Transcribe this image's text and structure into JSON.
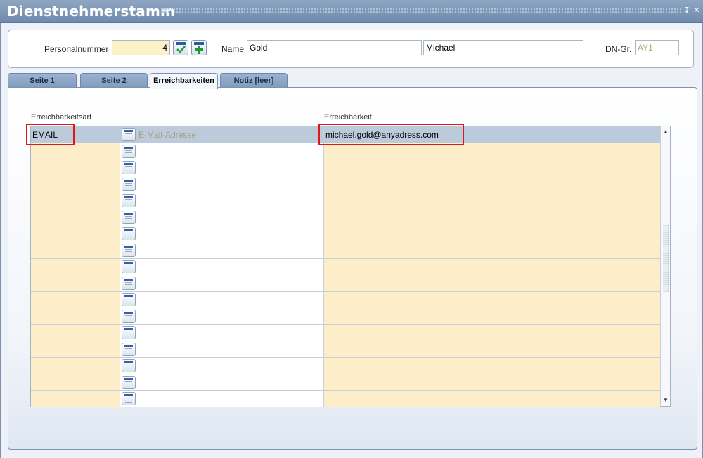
{
  "window": {
    "title": "Dienstnehmerstamm",
    "controls": [
      "minimize-icon",
      "close-icon"
    ]
  },
  "header": {
    "personalnummer_label": "Personalnummer",
    "personalnummer_value": "4",
    "name_label": "Name",
    "last_name": "Gold",
    "first_name": "Michael",
    "dn_gr_label": "DN-Gr.",
    "dn_gr_value": "AY1"
  },
  "tabs": [
    {
      "label": "Seite 1",
      "active": false
    },
    {
      "label": "Seite 2",
      "active": false
    },
    {
      "label": "Erreichbarkeiten",
      "active": true
    },
    {
      "label": "Notiz [leer]",
      "active": false
    }
  ],
  "grid": {
    "col_type_header": "Erreichbarkeitsart",
    "col_value_header": "Erreichbarkeit",
    "rows": [
      {
        "type": "EMAIL",
        "description": "E-Mail-Adresse",
        "value": "michael.gold@anyadress.com",
        "selected": true
      },
      {
        "type": "",
        "description": "",
        "value": ""
      },
      {
        "type": "",
        "description": "",
        "value": ""
      },
      {
        "type": "",
        "description": "",
        "value": ""
      },
      {
        "type": "",
        "description": "",
        "value": ""
      },
      {
        "type": "",
        "description": "",
        "value": ""
      },
      {
        "type": "",
        "description": "",
        "value": ""
      },
      {
        "type": "",
        "description": "",
        "value": ""
      },
      {
        "type": "",
        "description": "",
        "value": ""
      },
      {
        "type": "",
        "description": "",
        "value": ""
      },
      {
        "type": "",
        "description": "",
        "value": ""
      },
      {
        "type": "",
        "description": "",
        "value": ""
      },
      {
        "type": "",
        "description": "",
        "value": ""
      },
      {
        "type": "",
        "description": "",
        "value": ""
      },
      {
        "type": "",
        "description": "",
        "value": ""
      },
      {
        "type": "",
        "description": "",
        "value": ""
      },
      {
        "type": "",
        "description": "",
        "value": ""
      }
    ]
  },
  "colors": {
    "highlight": "#e0161b",
    "yellow_cell": "#fdeec9",
    "selected_row": "#bccbdc"
  }
}
